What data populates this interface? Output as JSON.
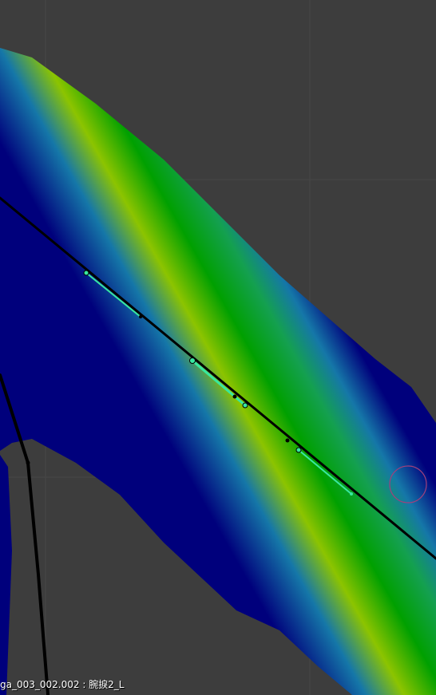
{
  "viewport": {
    "status": "ga_003_002.002 : 腕捩2_L",
    "weight_colors": {
      "zero": "#00007c",
      "low": "#1577a8",
      "mid": "#00a000",
      "high": "#8cc400"
    },
    "background": "#3d3d3d",
    "grid": "#464646",
    "selected_bone": "#38e8a0",
    "bone_outline": "#000000",
    "brush_cursor": "#a0407c"
  }
}
